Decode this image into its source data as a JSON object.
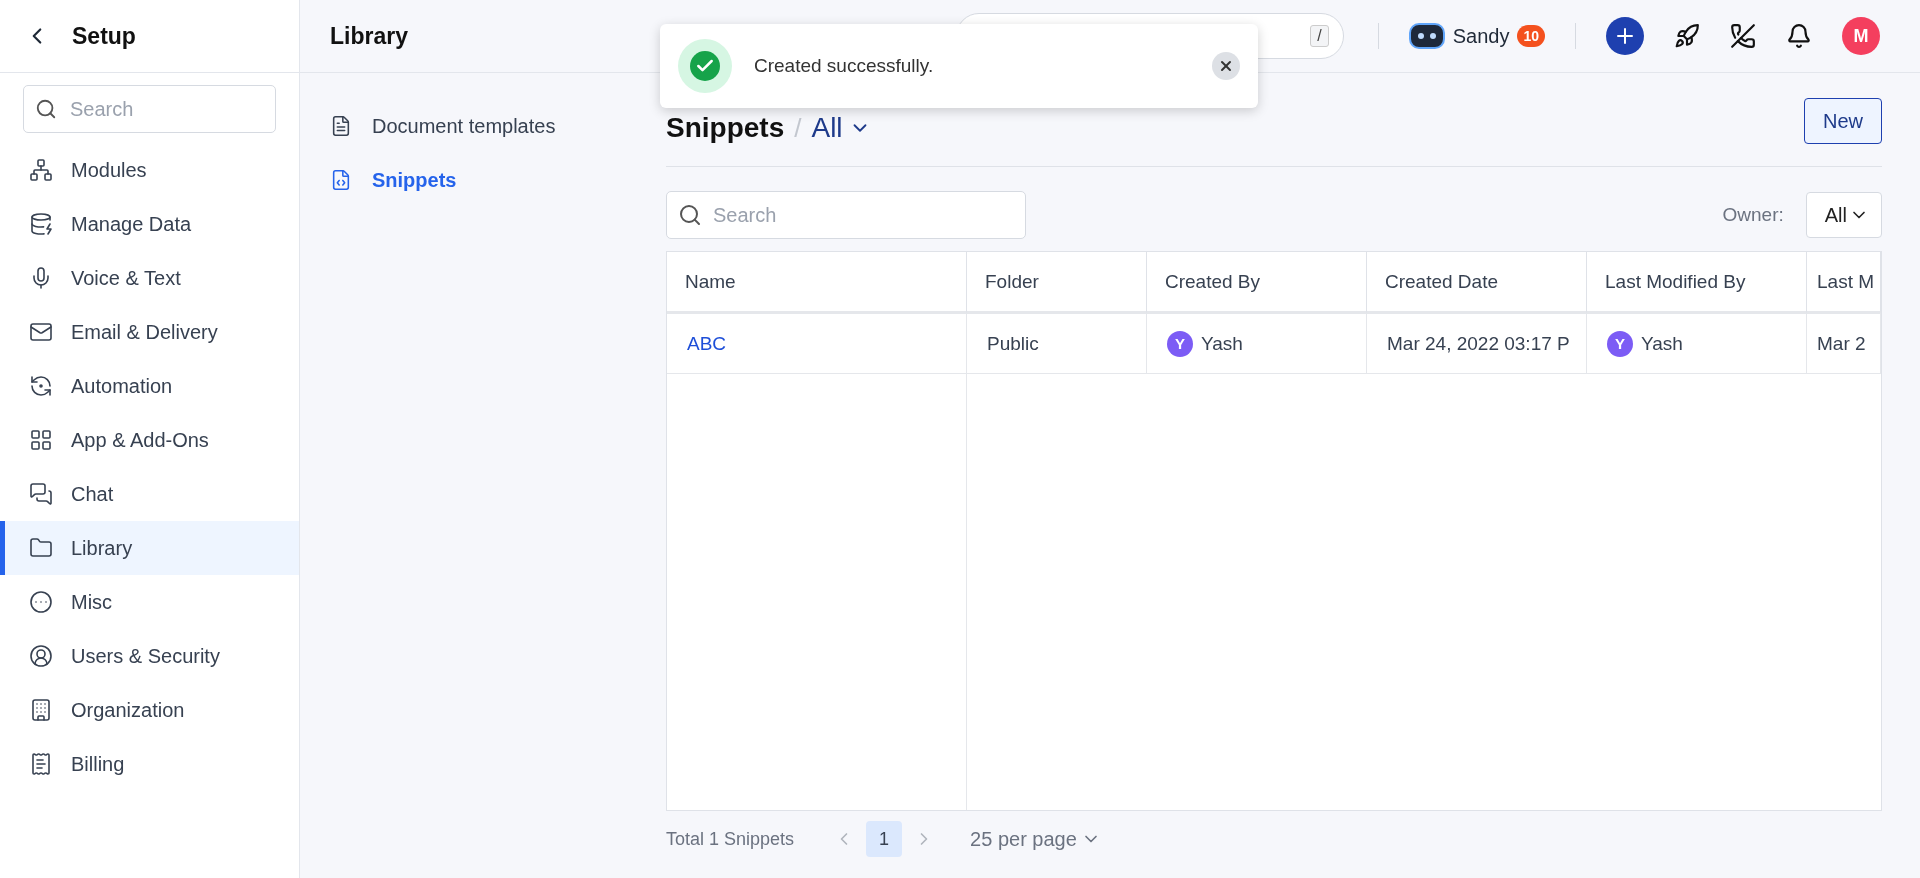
{
  "sidebar": {
    "title": "Setup",
    "search": {
      "placeholder": "Search"
    },
    "items": [
      {
        "label": "Modules",
        "selected": false
      },
      {
        "label": "Manage Data",
        "selected": false
      },
      {
        "label": "Voice & Text",
        "selected": false
      },
      {
        "label": "Email & Delivery",
        "selected": false
      },
      {
        "label": "Automation",
        "selected": false
      },
      {
        "label": "App & Add-Ons",
        "selected": false
      },
      {
        "label": "Chat",
        "selected": false
      },
      {
        "label": "Library",
        "selected": true
      },
      {
        "label": "Misc",
        "selected": false
      },
      {
        "label": "Users & Security",
        "selected": false
      },
      {
        "label": "Organization",
        "selected": false
      },
      {
        "label": "Billing",
        "selected": false
      }
    ]
  },
  "subnav": {
    "title": "Library",
    "items": [
      {
        "label": "Document templates",
        "selected": false
      },
      {
        "label": "Snippets",
        "selected": true
      }
    ]
  },
  "topbar": {
    "search_key": "/",
    "user": {
      "name": "Sandy",
      "badge": "10"
    },
    "avatar": "M"
  },
  "toast": {
    "message": "Created successfully."
  },
  "content": {
    "title": "Snippets",
    "separator": "/",
    "filter": "All",
    "new_button": "New",
    "search": {
      "placeholder": "Search"
    },
    "owner": {
      "label": "Owner:",
      "value": "All"
    },
    "table": {
      "columns": [
        "Name",
        "Folder",
        "Created By",
        "Created Date",
        "Last Modified By",
        "Last M"
      ],
      "rows": [
        {
          "name": "ABC",
          "folder": "Public",
          "created_by": {
            "initial": "Y",
            "name": "Yash"
          },
          "created_date": "Mar 24, 2022 03:17 P",
          "modified_by": {
            "initial": "Y",
            "name": "Yash"
          },
          "column_6": "Mar 2"
        }
      ]
    },
    "pagination": {
      "total": "Total 1 Snippets",
      "pages": [
        {
          "label": "1",
          "selected": true
        }
      ],
      "per_page": "25 per page"
    }
  }
}
